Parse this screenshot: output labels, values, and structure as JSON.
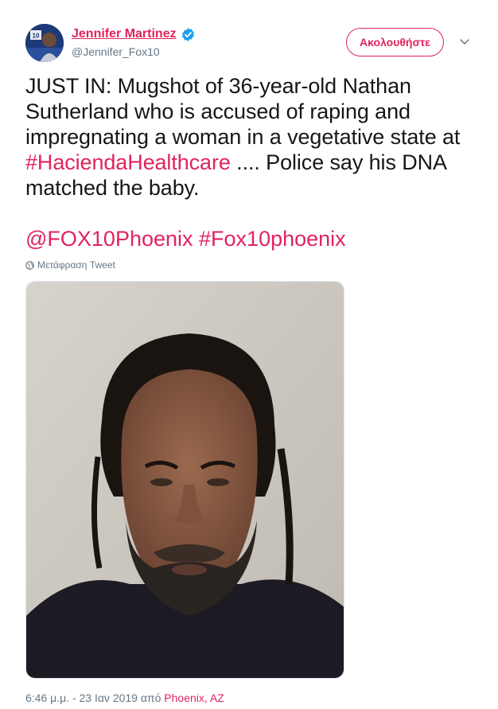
{
  "author": {
    "display_name": "Jennifer Martinez",
    "handle": "@Jennifer_Fox10",
    "verified": true,
    "avatar_badge": "10"
  },
  "actions": {
    "follow_label": "Ακολουθήστε"
  },
  "tweet": {
    "text_part1": "JUST IN: Mugshot of 36-year-old Nathan Sutherland who is accused of raping and impregnating a woman in a vegetative state at ",
    "hashtag1": "#HaciendaHealthcare",
    "text_part2": " .... Police say his DNA matched the baby.",
    "mention1": "@FOX10Phoenix",
    "hashtag2": "#Fox10phoenix",
    "translate_label": "Μετάφραση Tweet"
  },
  "meta": {
    "timestamp": "6:46 μ.μ. - 23 Ιαν 2019 από ",
    "location": "Phoenix, AZ"
  },
  "colors": {
    "accent": "#e0245e",
    "secondary_text": "#657786",
    "verified": "#1da1f2"
  }
}
